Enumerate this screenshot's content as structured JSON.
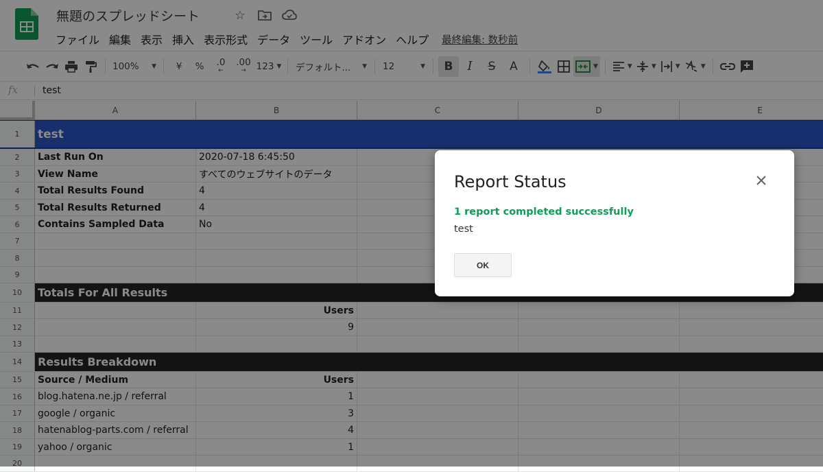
{
  "header": {
    "doc_title": "無題のスプレッドシート",
    "menu": [
      "ファイル",
      "編集",
      "表示",
      "挿入",
      "表示形式",
      "データ",
      "ツール",
      "アドオン",
      "ヘルプ"
    ],
    "last_edit": "最終編集: 数秒前"
  },
  "toolbar": {
    "zoom": "100%",
    "currency": "¥",
    "percent": "%",
    "decimal_decrease": ".0",
    "decimal_increase": ".00",
    "number_format": "123",
    "font": "デフォルト...",
    "font_size": "12",
    "bold": "B",
    "italic": "I",
    "strike": "S",
    "text_color": "A"
  },
  "formula_bar": {
    "fx": "fx",
    "value": "test"
  },
  "columns": [
    "A",
    "B",
    "C",
    "D",
    "E"
  ],
  "rows": {
    "r1": {
      "num": "1",
      "a": "test"
    },
    "r2": {
      "num": "2",
      "a": "Last Run On",
      "b": "2020-07-18 6:45:50"
    },
    "r3": {
      "num": "3",
      "a": "View Name",
      "b": "すべてのウェブサイトのデータ"
    },
    "r4": {
      "num": "4",
      "a": "Total Results Found",
      "b": "4"
    },
    "r5": {
      "num": "5",
      "a": "Total Results Returned",
      "b": "4"
    },
    "r6": {
      "num": "6",
      "a": "Contains Sampled Data",
      "b": "No"
    },
    "r7": {
      "num": "7"
    },
    "r8": {
      "num": "8"
    },
    "r9": {
      "num": "9"
    },
    "r10": {
      "num": "10",
      "a": "Totals For All Results"
    },
    "r11": {
      "num": "11",
      "b": "Users"
    },
    "r12": {
      "num": "12",
      "b": "9"
    },
    "r13": {
      "num": "13"
    },
    "r14": {
      "num": "14",
      "a": "Results Breakdown"
    },
    "r15": {
      "num": "15",
      "a": "Source / Medium",
      "b": "Users"
    },
    "r16": {
      "num": "16",
      "a": "blog.hatena.ne.jp / referral",
      "b": "1"
    },
    "r17": {
      "num": "17",
      "a": "google / organic",
      "b": "3"
    },
    "r18": {
      "num": "18",
      "a": "hatenablog-parts.com / referral",
      "b": "4"
    },
    "r19": {
      "num": "19",
      "a": "yahoo / organic",
      "b": "1"
    },
    "r20": {
      "num": "20"
    }
  },
  "dialog": {
    "title": "Report Status",
    "success": "1 report completed successfully",
    "message": "test",
    "ok": "OK"
  },
  "colors": {
    "sheets_green": "#0f9d58",
    "title_row_blue": "#2b57c7",
    "section_row_dark": "#262626",
    "success_green": "#0f9d58"
  },
  "icons": [
    "sheets-logo-icon",
    "star-icon",
    "move-folder-icon",
    "cloud-status-icon",
    "undo-icon",
    "redo-icon",
    "print-icon",
    "paint-format-icon",
    "fill-color-icon",
    "borders-icon",
    "merge-cells-icon",
    "align-left-icon",
    "vertical-align-icon",
    "text-wrap-icon",
    "text-rotate-icon",
    "link-icon",
    "insert-comment-icon",
    "close-icon"
  ]
}
